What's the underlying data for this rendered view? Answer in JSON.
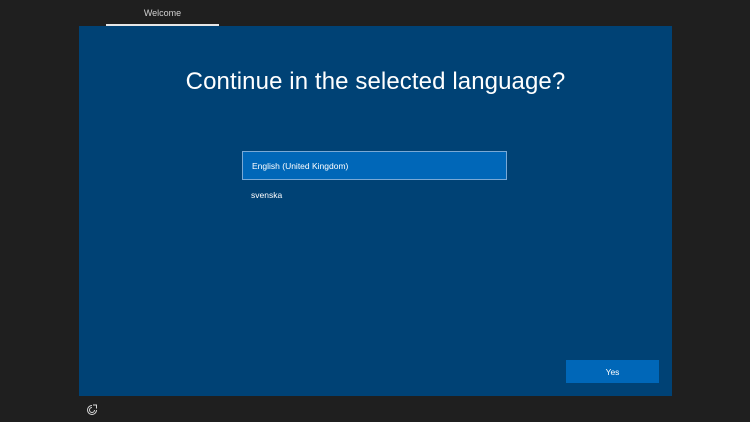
{
  "header": {
    "step_label": "Welcome"
  },
  "main": {
    "title": "Continue in the selected language?",
    "languages": [
      {
        "label": "English (United Kingdom)",
        "selected": true
      },
      {
        "label": "svenska",
        "selected": false
      }
    ],
    "yes_label": "Yes"
  },
  "footer": {
    "icon": "ease-of-access-icon"
  },
  "colors": {
    "panel": "#004275",
    "accent": "#0067b8",
    "background": "#1f1f1f"
  }
}
